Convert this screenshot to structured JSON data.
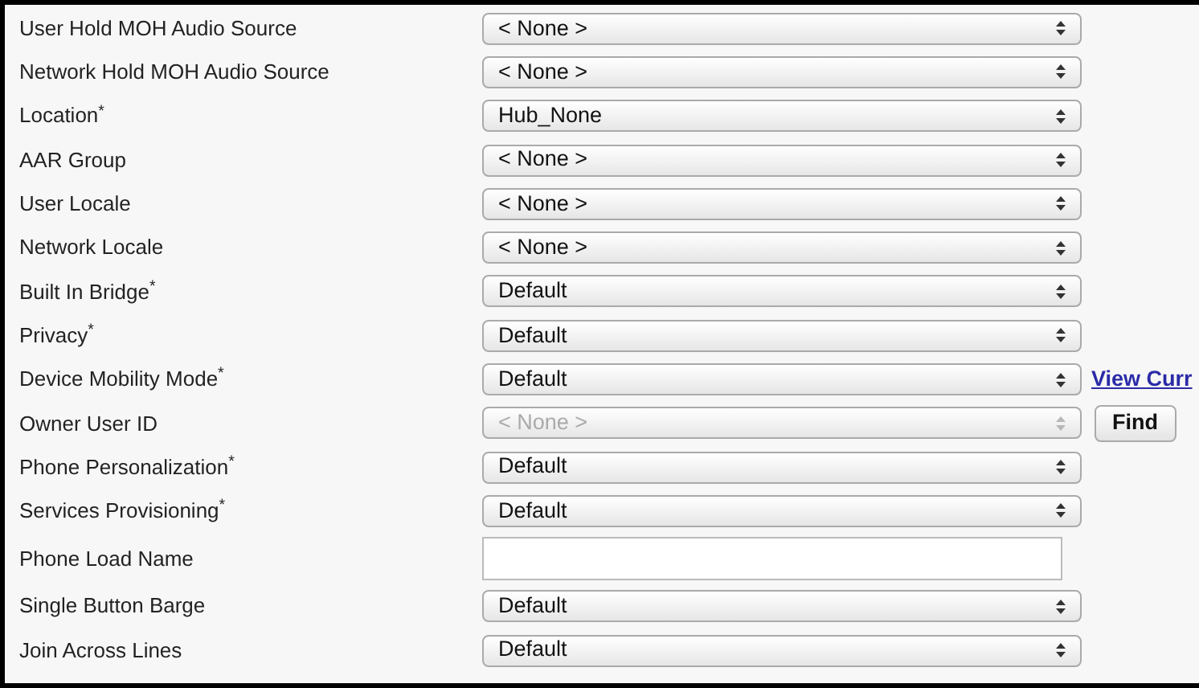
{
  "fields": [
    {
      "label": "User Hold MOH Audio Source",
      "kind": "select",
      "value": "< None >",
      "disabled": false
    },
    {
      "label": "Network Hold MOH Audio Source",
      "kind": "select",
      "value": "< None >",
      "disabled": false
    },
    {
      "label": "Location$^{*}$",
      "kind": "select",
      "value": "Hub_None",
      "disabled": false
    },
    {
      "label": "AAR Group",
      "kind": "select",
      "value": "< None >",
      "disabled": false
    },
    {
      "label": "User Locale",
      "kind": "select",
      "value": "< None >",
      "disabled": false
    },
    {
      "label": "Network Locale",
      "kind": "select",
      "value": "< None >",
      "disabled": false
    },
    {
      "label": "Built In Bridge$^{*}$",
      "kind": "select",
      "value": "Default",
      "disabled": false
    },
    {
      "label": "Privacy$^{*}$",
      "kind": "select",
      "value": "Default",
      "disabled": false
    },
    {
      "label": "Device Mobility Mode$^{*}$",
      "kind": "select",
      "value": "Default",
      "disabled": false,
      "link": "View Curr"
    },
    {
      "label": "Owner User ID",
      "kind": "select",
      "value": "< None >",
      "disabled": true,
      "button": "Find"
    },
    {
      "label": "Phone Personalization$^{*}$",
      "kind": "select",
      "value": "Default",
      "disabled": false
    },
    {
      "label": "Services Provisioning$^{*}$",
      "kind": "select",
      "value": "Default",
      "disabled": false
    },
    {
      "label": "Phone Load Name",
      "kind": "text"
    },
    {
      "label": "Single Button Barge",
      "kind": "select",
      "value": "Default",
      "disabled": false
    },
    {
      "label": "Join Across Lines",
      "kind": "select",
      "value": "Default",
      "disabled": false
    }
  ]
}
